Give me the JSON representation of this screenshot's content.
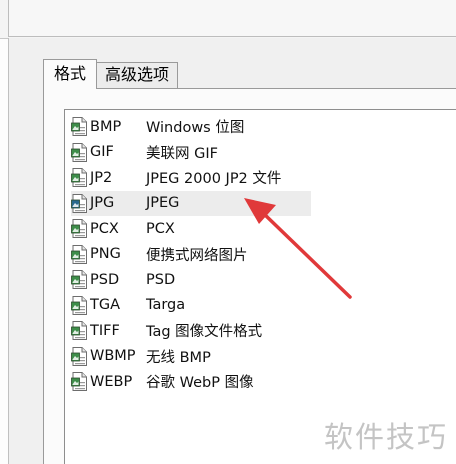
{
  "tabs": [
    {
      "label": "格式",
      "active": true
    },
    {
      "label": "高级选项",
      "active": false
    }
  ],
  "formats": [
    {
      "ext": "BMP",
      "desc": "Windows 位图"
    },
    {
      "ext": "GIF",
      "desc": "美联网 GIF"
    },
    {
      "ext": "JP2",
      "desc": "JPEG 2000 JP2 文件"
    },
    {
      "ext": "JPG",
      "desc": "JPEG"
    },
    {
      "ext": "PCX",
      "desc": "PCX"
    },
    {
      "ext": "PNG",
      "desc": "便携式网络图片"
    },
    {
      "ext": "PSD",
      "desc": "PSD"
    },
    {
      "ext": "TGA",
      "desc": "Targa"
    },
    {
      "ext": "TIFF",
      "desc": "Tag 图像文件格式"
    },
    {
      "ext": "WBMP",
      "desc": "无线 BMP"
    },
    {
      "ext": "WEBP",
      "desc": "谷歌 WebP 图像"
    }
  ],
  "highlighted_index": 3,
  "icon": "image-file-icon",
  "annotation_arrow_color": "#e0393a",
  "watermark": "软件技巧"
}
